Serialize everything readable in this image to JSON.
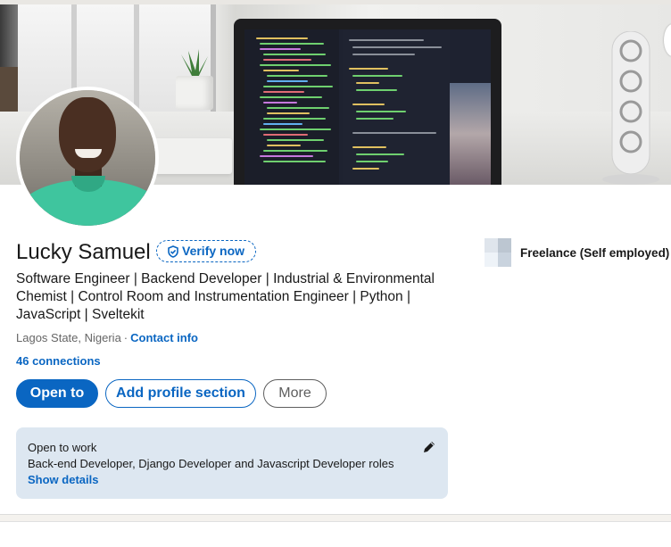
{
  "profile": {
    "name": "Lucky Samuel",
    "verify_label": "Verify now",
    "headline": "Software Engineer | Backend Developer | Industrial & Environmental Chemist | Control Room and Instrumentation Engineer | Python | JavaScript | Sveltekit",
    "location": "Lagos State, Nigeria",
    "separator": "·",
    "contact_info": "Contact info",
    "connections": "46 connections"
  },
  "actions": {
    "open_to": "Open to",
    "add_profile_section": "Add profile section",
    "more": "More"
  },
  "open_to_work": {
    "title": "Open to work",
    "roles": "Back-end Developer, Django Developer and Javascript Developer roles",
    "show_details": "Show details"
  },
  "experience": {
    "current": "Freelance (Self employed)"
  },
  "icons": {
    "verify": "shield-check-icon",
    "edit": "pencil-icon"
  },
  "colors": {
    "accent": "#0a66c2",
    "open_to_work_bg": "#dde7f1"
  }
}
